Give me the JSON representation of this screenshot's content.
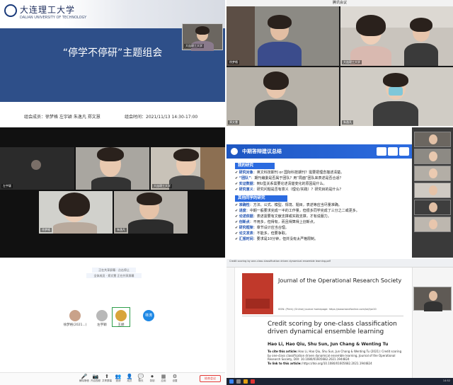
{
  "panel1": {
    "logo_text": "大连理工大学",
    "logo_sub": "DALIAN UNIVERSITY OF TECHNOLOGY",
    "slide_title": "“停学不停研”主题组会",
    "members": "组会成员：徐梦格 左宇颖 朱逸凡 郑文慧",
    "time": "组会时间：2021/11/13 14:30-17:00",
    "thumb_name": "大连理工大学"
  },
  "panel2": {
    "window_title": "腾讯会议",
    "names": [
      "徐梦格",
      "大连理工大学",
      "郑文慧",
      "朱逸凡"
    ]
  },
  "panel3": {
    "names": [
      "左宇颖",
      "大连理工大学",
      "徐梦格",
      "朱逸凡"
    ]
  },
  "panel4": {
    "slide_title": "中期答辩建议总结",
    "section1": "我的研究",
    "items1": [
      {
        "kw": "研究对象",
        "text": "：英文科技期刊 or 国际科技期刊？需要把理念描述清楚。"
      },
      {
        "kw": "“团队”",
        "text": "：期刊编委是否属于团队？用“局面”团队来表述是否合适？"
      },
      {
        "kw": "实证数据",
        "text": "：倒U型关系需要论述清楚变化的原因是什么。"
      },
      {
        "kw": "研究意义",
        "text": "：研究问题是否有意义（理论/实践）？研究目的是什么？"
      }
    ],
    "section2": "其他同学的研究",
    "items2": [
      {
        "kw": "准确性",
        "text": "：方法、公式、模型、情境、题目，表述等应当尽量准确。"
      },
      {
        "kw": "进度",
        "text": "：中期一般要求完成一半的工作量，但很多同学完成了三分之二或更多。"
      },
      {
        "kw": "论述依据",
        "text": "：表述需要有文献支撑或实践支撑，才有说服力。"
      },
      {
        "kw": "创新点",
        "text": "：不用多，但得有，而且得算得上创新点。"
      },
      {
        "kw": "研究框架",
        "text": "：章节设计应当合理。"
      },
      {
        "kw": "论文发表",
        "text": "：不能多，但要争取。"
      },
      {
        "kw": "汇报时间",
        "text": "：要求是10分钟，但并没有太严格限制。"
      }
    ]
  },
  "panel5": {
    "notice1": "正在共享屏幕 · 点击停止",
    "notice2": "全体成员 · 郑文慧 正在共享屏幕",
    "avatars": [
      {
        "name": "徐梦格(2021...)",
        "color": "#c9a28a"
      },
      {
        "name": "左宇颖",
        "color": "#b8b8b8"
      },
      {
        "name": "王赫",
        "color": "#d8a53a"
      },
      {
        "name": "林涛",
        "color": "#1e88e5"
      }
    ],
    "toolbar": [
      {
        "icon": "🎤",
        "label": "解除静音"
      },
      {
        "icon": "📷",
        "label": "开启视频"
      },
      {
        "icon": "⬆",
        "label": "共享屏幕"
      },
      {
        "icon": "👥",
        "label": "邀请"
      },
      {
        "icon": "👤",
        "label": "成员"
      },
      {
        "icon": "💬",
        "label": "聊天"
      },
      {
        "icon": "⏺",
        "label": "录制"
      },
      {
        "icon": "▦",
        "label": "应用"
      },
      {
        "icon": "⚙",
        "label": "设置"
      }
    ],
    "end_label": "结束会议"
  },
  "panel6": {
    "browser_line": "Credit scoring by one-class classification driven dynamical ensemble learning.pdf",
    "journal": "Journal of the Operational Research Society",
    "issn": "ISSN: (Print) (Online) Journal homepage: https://www.tandfonline.com/loi/tjor20",
    "paper_title": "Credit scoring by one-class classification driven dynamical ensemble learning",
    "authors": "Hao Li, Hao Qiu, Shu Sun, Jun Chang & Wenting Tu",
    "cite_label": "To cite this article:",
    "cite_text": "Hao Li, Hao Qiu, Shu Sun, Jun Chang & Wenting Tu (2021): Credit scoring by one-class classification driven dynamical ensemble learning, Journal of the Operational Research Society, DOI: 10.1080/01605682.2021.1944824",
    "link_label": "To link to this article:",
    "link_text": "https://doi.org/10.1080/01605682.2021.1944824",
    "clock": "14:52"
  }
}
